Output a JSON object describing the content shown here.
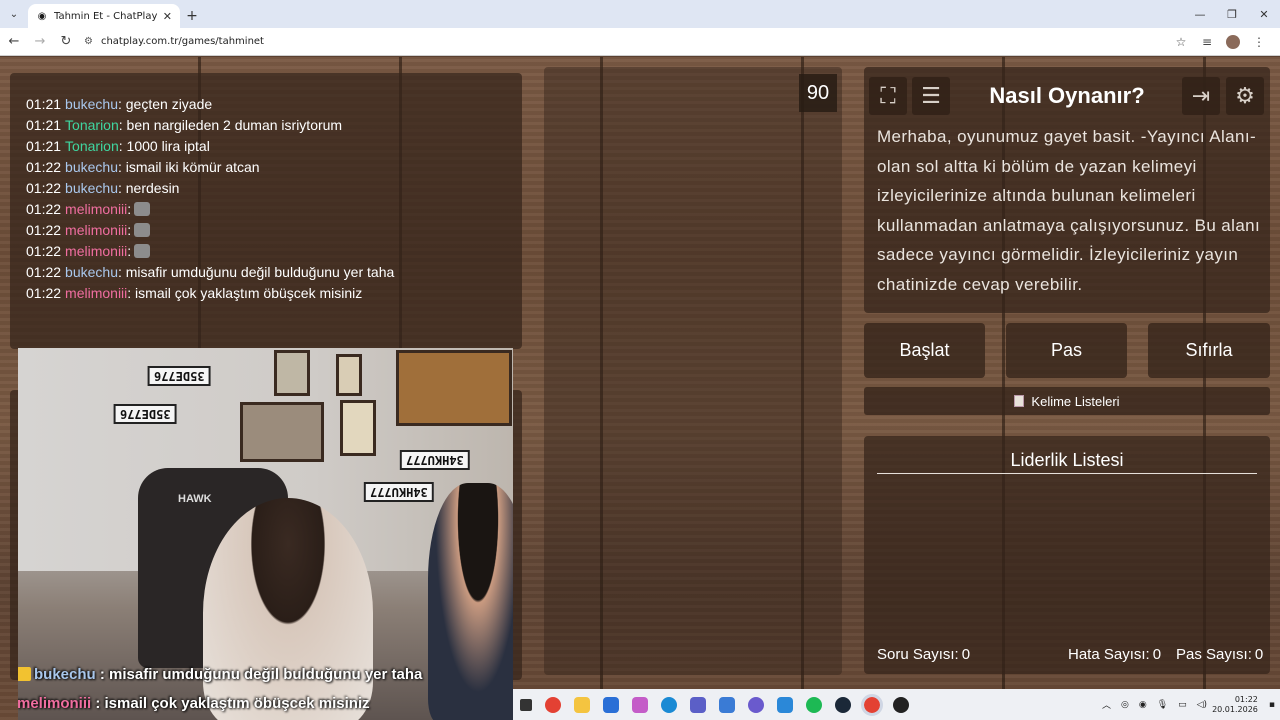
{
  "browser": {
    "tab_title": "Tahmin Et - ChatPlay",
    "url": "chatplay.com.tr/games/tahminet"
  },
  "chat": [
    {
      "time": "01:21",
      "user": "bukechu",
      "color": "#a9c7ec",
      "msg": ": geçten ziyade"
    },
    {
      "time": "01:21",
      "user": "Tonarion",
      "color": "#3fd6a0",
      "msg": ": ben nargileden 2 duman isriytorum"
    },
    {
      "time": "01:21",
      "user": "Tonarion",
      "color": "#3fd6a0",
      "msg": ": 1000 lira iptal"
    },
    {
      "time": "01:22",
      "user": "bukechu",
      "color": "#a9c7ec",
      "msg": ": ismail iki kömür atcan"
    },
    {
      "time": "01:22",
      "user": "bukechu",
      "color": "#a9c7ec",
      "msg": ": nerdesin"
    },
    {
      "time": "01:22",
      "user": "melimoniii",
      "color": "#f06ea0",
      "msg": ":",
      "emote": true
    },
    {
      "time": "01:22",
      "user": "melimoniii",
      "color": "#f06ea0",
      "msg": ":",
      "emote": true
    },
    {
      "time": "01:22",
      "user": "melimoniii",
      "color": "#f06ea0",
      "msg": ":",
      "emote": true
    },
    {
      "time": "01:22",
      "user": "bukechu",
      "color": "#a9c7ec",
      "msg": ": misafir umduğunu değil bulduğunu yer taha"
    },
    {
      "time": "01:22",
      "user": "melimoniii",
      "color": "#f06ea0",
      "msg": ": ismail çok yaklaştım öbüşcek misiniz"
    }
  ],
  "webcam": {
    "stickers": [
      "35DE776",
      "35DE776",
      "34HKU777",
      "34HKU777"
    ],
    "brand": "HAWK",
    "overlay": [
      {
        "user": "bukechu",
        "msg": " : misafir umduğunu değil bulduğunu yer taha"
      },
      {
        "user": "melimoniii",
        "msg": " : ismail çok yaklaştım öbüşcek misiniz"
      }
    ]
  },
  "timer": "90",
  "how_to": {
    "title": "Nasıl Oynanır?",
    "text": "Merhaba, oyunumuz gayet basit. -Yayıncı Alanı- olan sol altta ki bölüm de yazan kelimeyi izleyicilerinize altında bulunan kelimeleri kullanmadan anlatmaya çalışıyorsunuz. Bu alanı sadece yayıncı görmelidir. İzleyicileriniz yayın chatinizde cevap verebilir."
  },
  "controls": {
    "start": "Başlat",
    "pass": "Pas",
    "reset": "Sıfırla",
    "word_lists": "Kelime Listeleri"
  },
  "leaderboard": {
    "title": "Liderlik Listesi"
  },
  "stats": {
    "questions_label": "Soru Sayısı:",
    "questions": "0",
    "errors_label": "Hata Sayısı:",
    "errors": "0",
    "passes_label": "Pas Sayısı:",
    "passes": "0"
  },
  "taskbar": {
    "time": "01:22",
    "date": "20.01.2026"
  }
}
